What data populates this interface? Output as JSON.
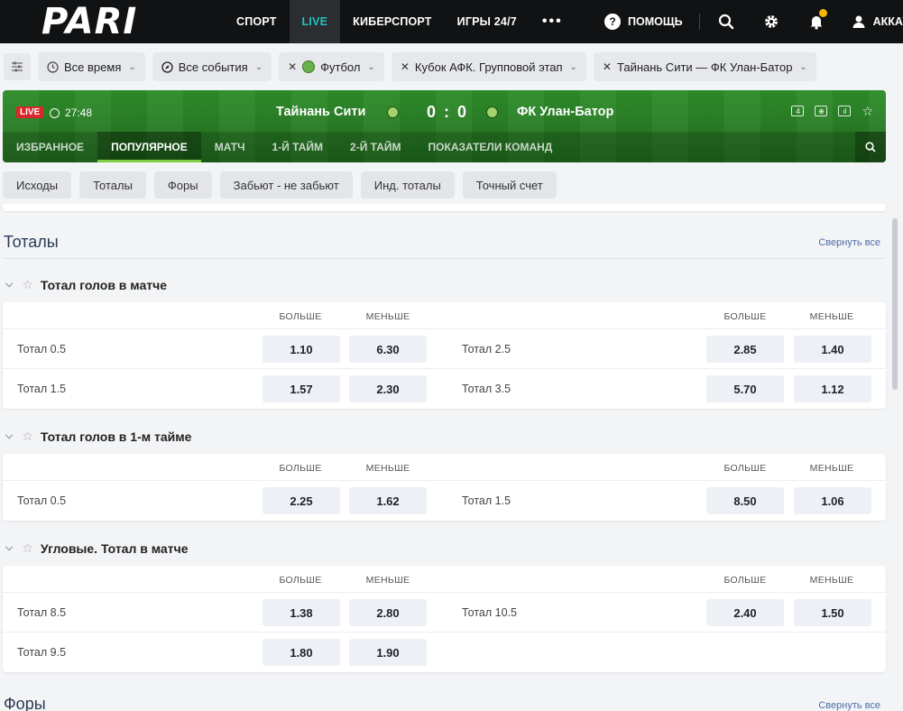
{
  "nav": {
    "logo": "PARI",
    "items": [
      {
        "label": "СПОРТ",
        "active": false
      },
      {
        "label": "LIVE",
        "active": true
      },
      {
        "label": "КИБЕРСПОРТ",
        "active": false
      },
      {
        "label": "ИГРЫ 24/7",
        "active": false
      }
    ],
    "more": "•••",
    "help": "ПОМОЩЬ",
    "account": "АККАУ"
  },
  "filters": {
    "time": "Все время",
    "events": "Все события",
    "sport": "Футбол",
    "tournament": "Кубок АФК. Групповой этап",
    "match": "Тайнань Сити — ФК Улан-Батор"
  },
  "event": {
    "live": "LIVE",
    "time": "27:48",
    "team1": "Тайнань Сити",
    "score": "0 : 0",
    "team2": "ФК Улан-Батор",
    "tabs": [
      "ИЗБРАННОЕ",
      "ПОПУЛЯРНОЕ",
      "МАТЧ",
      "1-Й ТАЙМ",
      "2-Й ТАЙМ",
      "ПОКАЗАТЕЛИ КОМАНД"
    ],
    "active_tab": "ПОПУЛЯРНОЕ"
  },
  "subfilters": [
    "Исходы",
    "Тоталы",
    "Форы",
    "Забьют - не забьют",
    "Инд. тоталы",
    "Точный счет"
  ],
  "sections": {
    "totals_title": "Тоталы",
    "collapse_all": "Свернуть все",
    "handicaps_title": "Форы"
  },
  "col_over": "БОЛЬШЕ",
  "col_under": "МЕНЬШЕ",
  "groups": [
    {
      "title": "Тотал голов в матче",
      "rows": [
        {
          "l1": "Тотал 0.5",
          "o1": "1.10",
          "u1": "6.30",
          "l2": "Тотал 2.5",
          "o2": "2.85",
          "u2": "1.40"
        },
        {
          "l1": "Тотал 1.5",
          "o1": "1.57",
          "u1": "2.30",
          "l2": "Тотал 3.5",
          "o2": "5.70",
          "u2": "1.12"
        }
      ]
    },
    {
      "title": "Тотал голов в 1-м тайме",
      "rows": [
        {
          "l1": "Тотал 0.5",
          "o1": "2.25",
          "u1": "1.62",
          "l2": "Тотал 1.5",
          "o2": "8.50",
          "u2": "1.06"
        }
      ]
    },
    {
      "title": "Угловые. Тотал в матче",
      "rows": [
        {
          "l1": "Тотал 8.5",
          "o1": "1.38",
          "u1": "2.80",
          "l2": "Тотал 10.5",
          "o2": "2.40",
          "u2": "1.50"
        },
        {
          "l1": "Тотал 9.5",
          "o1": "1.80",
          "u1": "1.90",
          "l2": "",
          "o2": "",
          "u2": ""
        }
      ]
    }
  ]
}
